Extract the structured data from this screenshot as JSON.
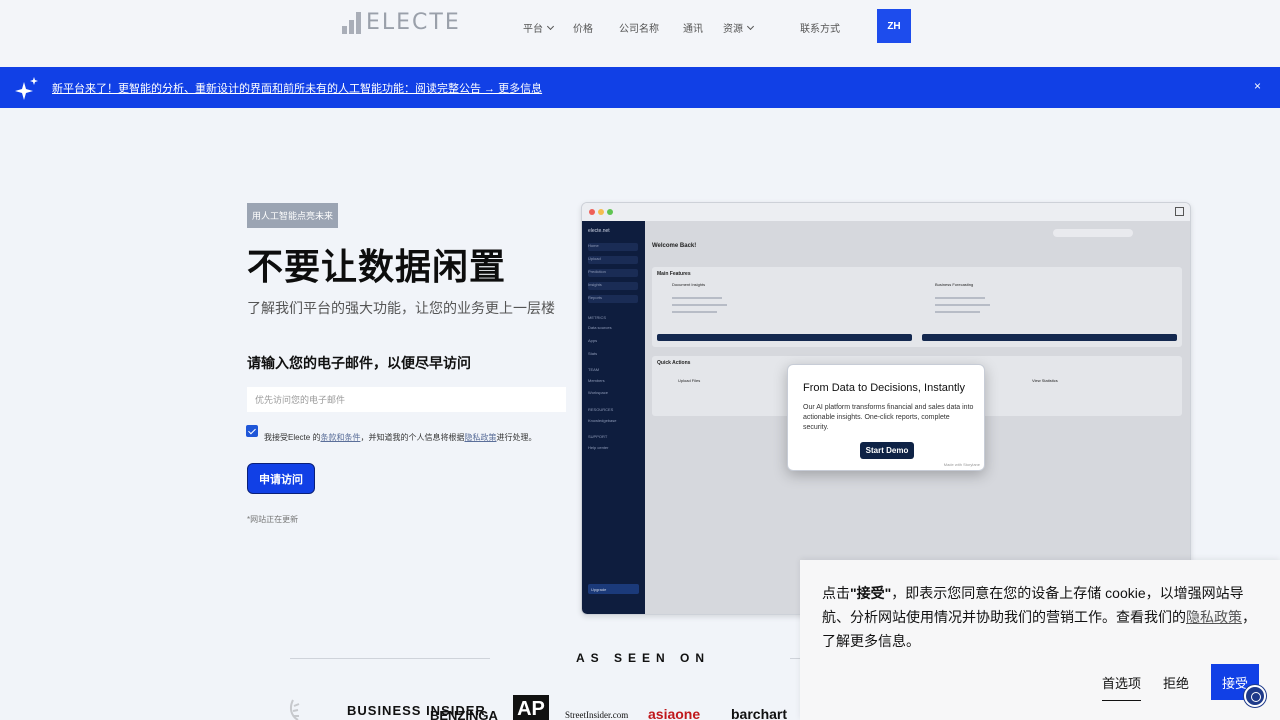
{
  "nav": {
    "logo_text": "ELECTE",
    "items": [
      "平台",
      "价格",
      "公司名称",
      "通讯",
      "资源",
      "联系方式"
    ],
    "lang": "ZH"
  },
  "announcement": {
    "text": "新平台来了！更智能的分析、重新设计的界面和前所未有的人工智能功能：阅读完整公告 → 更多信息",
    "close": "×"
  },
  "hero": {
    "badge": "用人工智能点亮未来",
    "title": "不要让数据闲置",
    "subtitle": "了解我们平台的强大功能，让您的业务更上一层楼",
    "email_label": "请输入您的电子邮件，以便尽早访问",
    "email_placeholder": "优先访问您的电子邮件",
    "consent_pre": "我接受Electe 的",
    "consent_terms": "条款和条件",
    "consent_mid": "，并知道我的个人信息将根据",
    "consent_privacy": "隐私政策",
    "consent_post": "进行处理。",
    "apply_button": "申请访问",
    "update_note": "*网站正在更新"
  },
  "preview": {
    "brand": "electe.net",
    "menu": [
      "Home",
      "Upload",
      "Prediction",
      "Insights",
      "Reports",
      "METRICS",
      "Data sources",
      "Apps",
      "Stats",
      "TEAM",
      "Members",
      "Workspace",
      "RESOURCES",
      "Knowledgebase",
      "SUPPORT",
      "Help center"
    ],
    "upgrade": "Upgrade",
    "welcome": "Welcome Back!",
    "main_features": "Main Features",
    "feature_1": "Document Insights",
    "feature_2": "Business Forecasting",
    "quick_actions": "Quick Actions",
    "qa_1": "Upload Files",
    "qa_2": "View Statistics"
  },
  "modal": {
    "title": "From Data to Decisions, Instantly",
    "body": "Our AI platform transforms financial and sales data into actionable insights. One-click reports, complete security.",
    "button": "Start Demo",
    "made_with": "Made with Storylane"
  },
  "seen_on": {
    "title": "AS SEEN ON",
    "logos": [
      "BUSINESS INSIDER",
      "BENZINGA",
      "AP",
      "StreetInsider.com",
      "asiaone",
      "barchart"
    ]
  },
  "cookie": {
    "text_pre": "点击",
    "text_bold": "\"接受\"",
    "text_mid": "，即表示您同意在您的设备上存储 cookie，以增强网站导航、分析网站使用情况并协助我们的营销工作。查看我们的",
    "privacy_link": "隐私政策",
    "text_post": "，了解更多信息。",
    "preferences": "首选项",
    "reject": "拒绝",
    "accept": "接受"
  },
  "colors": {
    "brand_blue": "#1140e6",
    "sidebar_navy": "#0e1d3e"
  }
}
